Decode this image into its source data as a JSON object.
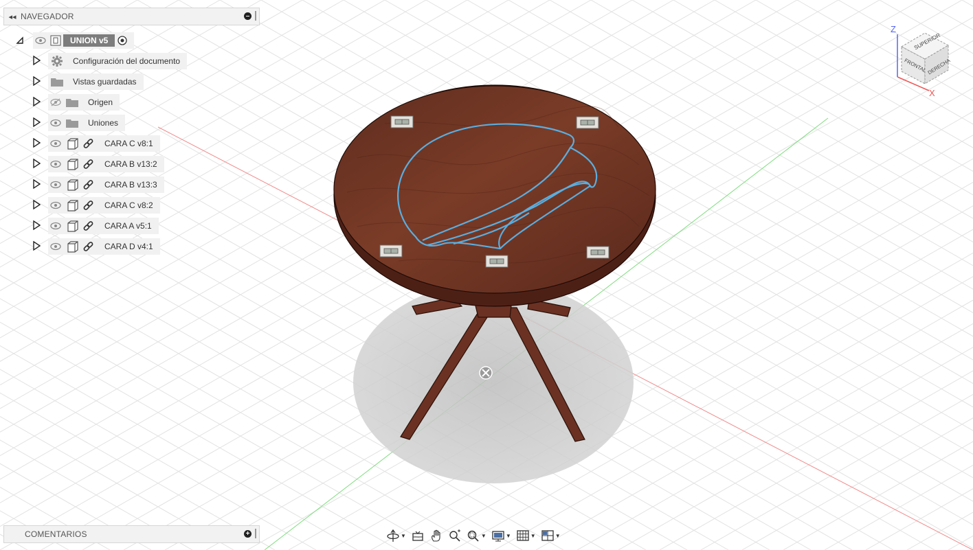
{
  "navigator": {
    "title": "NAVEGADOR",
    "root": {
      "label": "UNION v5"
    },
    "items": [
      {
        "label": "Configuración del documento",
        "icon": "gear-icon"
      },
      {
        "label": "Vistas guardadas",
        "icon": "folder-icon"
      },
      {
        "label": "Origen",
        "icon": "folder-icon",
        "visibility": "hidden"
      },
      {
        "label": "Uniones",
        "icon": "folder-icon",
        "visibility": "visible"
      },
      {
        "label": "CARA C v8:1",
        "icon": "linked-component-icon"
      },
      {
        "label": "CARA B v13:2",
        "icon": "linked-component-icon"
      },
      {
        "label": "CARA B v13:3",
        "icon": "linked-component-icon"
      },
      {
        "label": "CARA C v8:2",
        "icon": "linked-component-icon"
      },
      {
        "label": "CARA A v5:1",
        "icon": "linked-component-icon"
      },
      {
        "label": "CARA D v4:1",
        "icon": "linked-component-icon"
      }
    ]
  },
  "comments": {
    "title": "COMENTARIOS"
  },
  "viewcube": {
    "top": "SUPERIOR",
    "front": "FRONTAL",
    "right": "DERECHA",
    "axis_z": "Z",
    "axis_x": "X"
  },
  "toolbar": {
    "tools": [
      "orbit-icon",
      "look-at-icon",
      "pan-icon",
      "zoom-icon",
      "fit-icon",
      "display-settings-icon",
      "grid-icon",
      "viewports-icon"
    ]
  },
  "colors": {
    "wood": "#6e3424",
    "sketch": "#5aaee0",
    "axis_x": "#ee6a6a",
    "axis_y": "#66d466",
    "grid": "#dedede",
    "panel": "#f2f2f2",
    "root_badge": "#7d7d7d"
  }
}
